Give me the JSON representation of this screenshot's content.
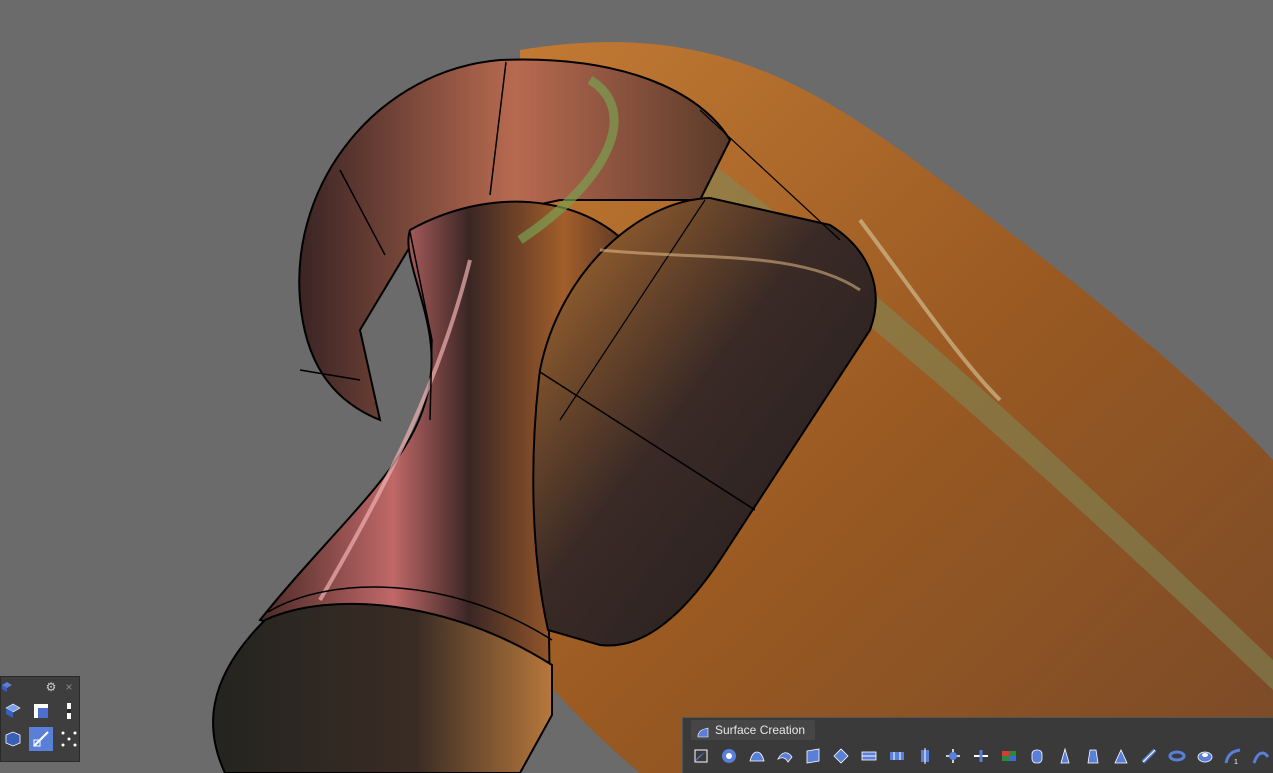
{
  "viewport": {
    "background_color": "#6b6b6b",
    "model_colors": {
      "copper": "#b46a2a",
      "dark": "#2a2222",
      "rose": "#c07070",
      "green": "#6a8a4a"
    }
  },
  "mini_toolbar": {
    "header_icon": "model-icon",
    "settings_icon": "gear-icon",
    "close_icon": "close-icon",
    "tools": [
      {
        "name": "surface-icon"
      },
      {
        "name": "square-icon"
      },
      {
        "name": "split-vertical-icon"
      },
      {
        "name": "box-icon"
      },
      {
        "name": "diagonal-icon"
      },
      {
        "name": "points-grid-icon"
      }
    ]
  },
  "surface_toolbar": {
    "tab_label": "Surface Creation",
    "tab_icon": "surface-creation-icon",
    "tools": [
      "surface-from-points-icon",
      "revolve-icon",
      "sweep1-icon",
      "sweep2-icon",
      "planar-surface-icon",
      "network-surface-icon",
      "loft-icon",
      "rail-revolve-icon",
      "extrude-icon",
      "patch-icon",
      "edge-surface-icon",
      "heightfield-icon",
      "cylinder-icon",
      "cone-icon",
      "pyramid-icon",
      "tetra-icon",
      "pipe-icon",
      "torus-icon",
      "ellipsoid-icon",
      "blend-icon",
      "fillet-icon"
    ],
    "accent_color": "#5a7fd8"
  }
}
